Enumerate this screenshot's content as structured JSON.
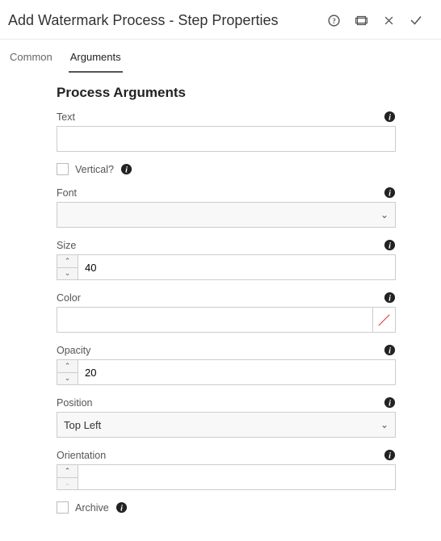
{
  "title": "Add Watermark Process - Step Properties",
  "tabs": {
    "common": "Common",
    "arguments": "Arguments",
    "active": "arguments"
  },
  "section_heading": "Process Arguments",
  "fields": {
    "text": {
      "label": "Text",
      "value": ""
    },
    "vertical": {
      "label": "Vertical?",
      "checked": false
    },
    "font": {
      "label": "Font",
      "value": ""
    },
    "size": {
      "label": "Size",
      "value": "40"
    },
    "color": {
      "label": "Color",
      "value": ""
    },
    "opacity": {
      "label": "Opacity",
      "value": "20"
    },
    "position": {
      "label": "Position",
      "value": "Top Left"
    },
    "orientation": {
      "label": "Orientation",
      "value": ""
    },
    "archive": {
      "label": "Archive",
      "checked": false
    }
  }
}
